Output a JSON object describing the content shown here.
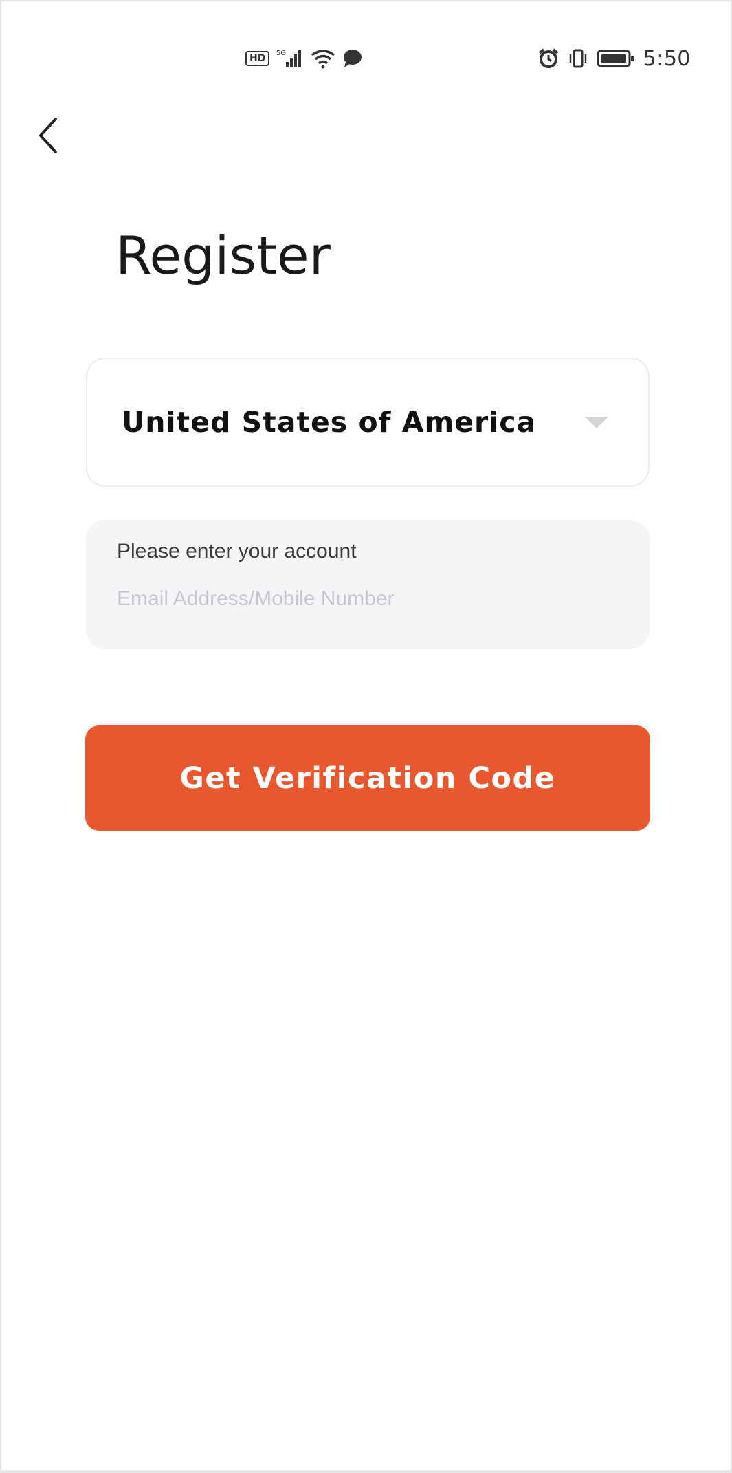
{
  "status_bar": {
    "hd_badge": "HD",
    "network_label": "5G",
    "time": "5:50",
    "icons": [
      "hd-icon",
      "signal-icon",
      "wifi-icon",
      "message-icon",
      "alarm-icon",
      "vibrate-icon",
      "battery-icon"
    ]
  },
  "header": {
    "back_icon": "chevron-left-icon"
  },
  "page": {
    "title": "Register"
  },
  "country_select": {
    "value": "United States of America",
    "icon": "triangle-down-icon"
  },
  "account_field": {
    "label": "Please enter your account",
    "placeholder": "Email Address/Mobile Number",
    "value": ""
  },
  "actions": {
    "verify_label": "Get Verification Code"
  },
  "colors": {
    "accent": "#e8572d",
    "field_bg": "#f5f5f8",
    "text": "#1a1a1a"
  }
}
